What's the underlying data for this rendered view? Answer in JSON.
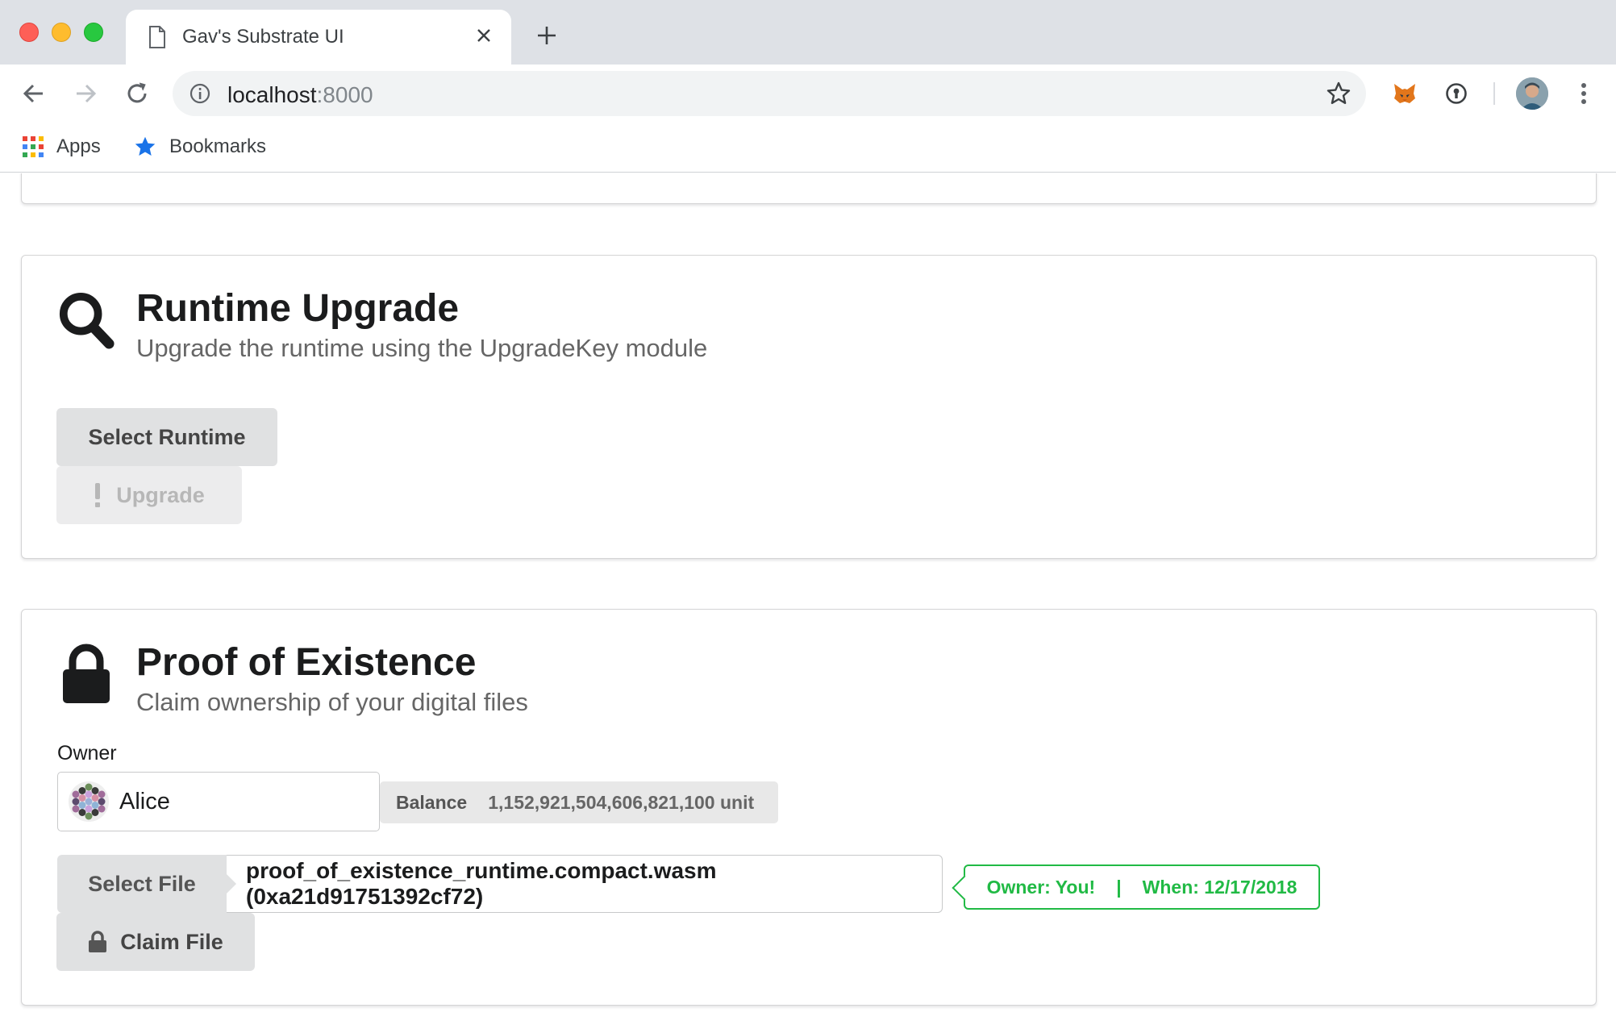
{
  "browser": {
    "tab_title": "Gav's Substrate UI",
    "url_host": "localhost",
    "url_port": ":8000",
    "bookmarks": [
      {
        "label": "Apps",
        "icon": "apps-grid-icon"
      },
      {
        "label": "Bookmarks",
        "icon": "star-icon"
      }
    ]
  },
  "runtime_upgrade": {
    "title": "Runtime Upgrade",
    "subtitle": "Upgrade the runtime using the UpgradeKey module",
    "icon": "search-icon",
    "select_runtime_label": "Select Runtime",
    "upgrade_label": "Upgrade"
  },
  "proof_of_existence": {
    "title": "Proof of Existence",
    "subtitle": "Claim ownership of your digital files",
    "icon": "lock-icon",
    "owner_label": "Owner",
    "owner_value": "Alice",
    "balance_label": "Balance",
    "balance_value": "1,152,921,504,606,821,100 unit",
    "select_file_label": "Select File",
    "file_name": "proof_of_existence_runtime.compact.wasm (0xa21d91751392cf72)",
    "ownership": {
      "owner_text": "Owner: You!",
      "separator": "|",
      "when_text": "When: 12/17/2018"
    },
    "claim_file_label": "Claim File"
  },
  "colors": {
    "success": "#21ba45",
    "button_bg": "#e0e1e2"
  }
}
